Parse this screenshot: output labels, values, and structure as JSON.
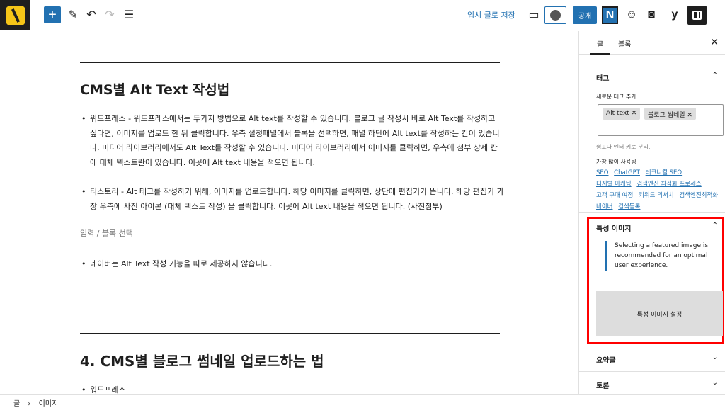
{
  "toolbar": {
    "save_draft": "임시 글로 저장",
    "publish": "공개",
    "n_label": "N",
    "y_label": "y"
  },
  "editor": {
    "heading1": "CMS별 Alt Text 작성법",
    "bullet1": "워드프레스 - 워드프레스에서는 두가지 방법으로 Alt text를 작성할 수 있습니다. 블로그 글 작성시 바로  Alt Text를 작성하고 싶다면, 이미지를 업로드 한 뒤 클릭합니다. 우측 설정패널에서 블록을 선택하면, 패널 하단에 Alt text를 작성하는 칸이 있습니다. 미디어 라이브러리에서도 Alt Text를 작성할 수 있습니다. 미디어 라이브러리에서 이미지를 클릭하면, 우측에 첨부 상세 칸에 대체 텍스트란이 있습니다. 이곳에 Alt text 내용을 적으면 됩니다.",
    "bullet2": "티스토리 - Alt 태그를 작성하기 위해, 이미지를 업로드합니다. 해당 이미지를 클릭하면, 상단에 편집기가 뜹니다. 해당 편집기 가장 우측에 사진 아이콘 (대체 텍스트 작성) 을 클릭합니다. 이곳에 Alt text 내용을 적으면 됩니다. (사진첨부)",
    "placeholder": "입력 / 블록 선택",
    "bullet3": "네이버는 Alt Text 작성 기능을 따로 제공하지 않습니다.",
    "heading2": "4. CMS별 블로그 썸네일 업로드하는 법",
    "bullet4": "워드프레스"
  },
  "statusbar": {
    "crumb1": "글",
    "sep": "›",
    "crumb2": "이미지"
  },
  "sidebar": {
    "tab_post": "글",
    "tab_block": "블록",
    "tags_title": "태그",
    "new_tag_label": "새로운 태그 추가",
    "tags": [
      "Alt text",
      "블로그 썸네일"
    ],
    "help_text": "쉼표나 엔터 키로 분리.",
    "most_used_label": "가장 많이 사용됨",
    "most_used": [
      "SEO",
      "ChatGPT",
      "테크니컬 SEO",
      "디지털 마케팅",
      "검색엔진 최적화 프로세스",
      "고객 구매 여정",
      "키워드 리서치",
      "검색엔진최적화",
      "네이버",
      "검색등록"
    ],
    "featured_title": "특성 이미지",
    "featured_notice": "Selecting a featured image is recommended for an optimal user experience.",
    "featured_button": "특성 이미지 설정",
    "excerpt_title": "요약글",
    "discussion_title": "토론"
  }
}
